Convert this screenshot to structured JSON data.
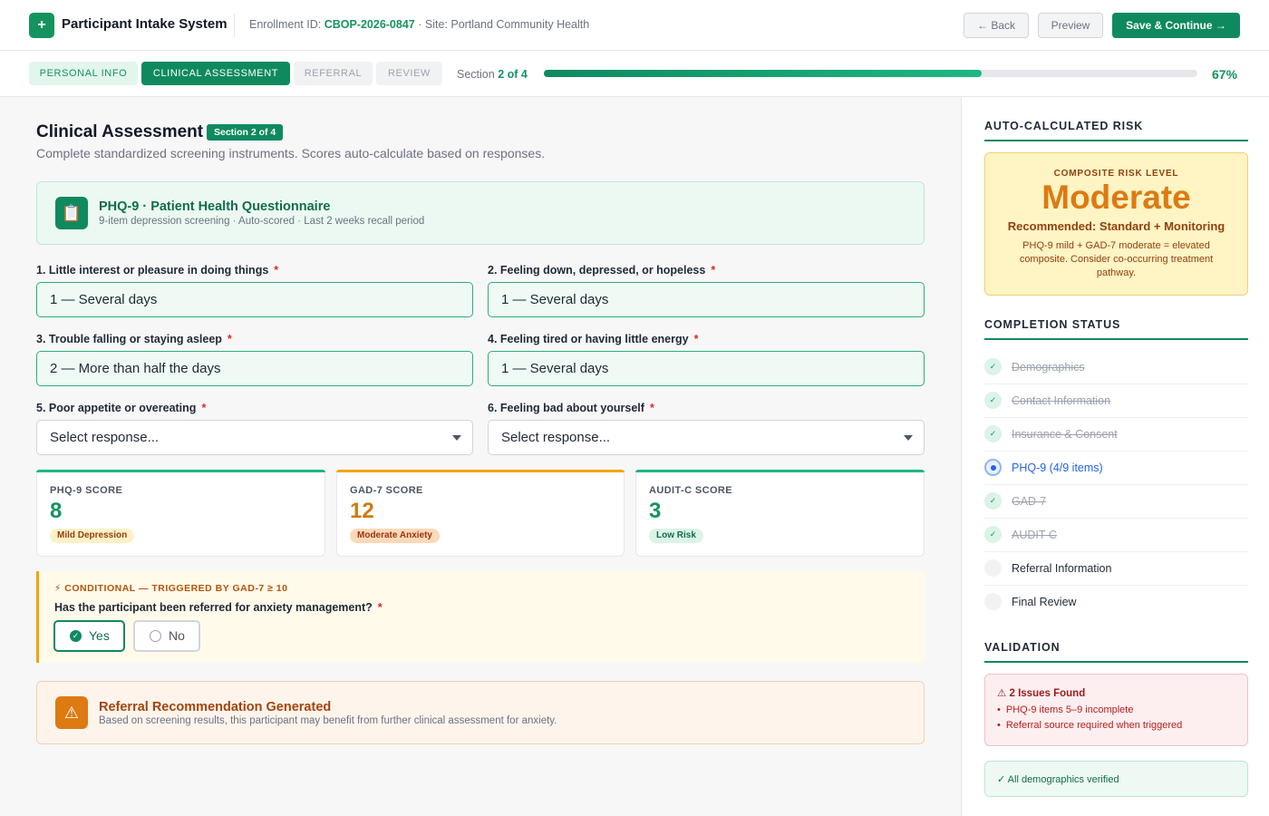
{
  "header": {
    "logo_glyph": "+",
    "app_title": "Participant Intake System",
    "enrollment_label": "Enrollment ID:",
    "enrollment_id": "CBOP-2026-0847",
    "site_text": "· Site: Portland Community Health",
    "back_label": "← Back",
    "preview_label": "Preview",
    "save_label": "Save & Continue →"
  },
  "tabs": [
    {
      "label": "PERSONAL INFO",
      "state": "done"
    },
    {
      "label": "CLINICAL ASSESSMENT",
      "state": "active"
    },
    {
      "label": "REFERRAL",
      "state": "future"
    },
    {
      "label": "REVIEW",
      "state": "future"
    }
  ],
  "progress": {
    "section_prefix": "Section",
    "section_value": "2 of 4",
    "percent": 67,
    "percent_label": "67%"
  },
  "page": {
    "title": "Clinical Assessment",
    "badge": "Section 2 of 4",
    "subtitle": "Complete standardized screening instruments. Scores auto-calculate based on responses."
  },
  "instrument": {
    "icon": "📋",
    "title": "PHQ-9 · Patient Health Questionnaire",
    "subtitle": "9-item depression screening · Auto-scored · Last 2 weeks recall period"
  },
  "questions": [
    {
      "label": "1. Little interest or pleasure in doing things",
      "required": "*",
      "value": "1 — Several days"
    },
    {
      "label": "2. Feeling down, depressed, or hopeless",
      "required": "*",
      "value": "1 — Several days"
    },
    {
      "label": "3. Trouble falling or staying asleep",
      "required": "*",
      "value": "2 — More than half the days"
    },
    {
      "label": "4. Feeling tired or having little energy",
      "required": "*",
      "value": "1 — Several days"
    },
    {
      "label": "5. Poor appetite or overeating",
      "required": "*",
      "placeholder": "Select response..."
    },
    {
      "label": "6. Feeling bad about yourself",
      "required": "*",
      "placeholder": "Select response..."
    }
  ],
  "scores": [
    {
      "label": "PHQ-9 SCORE",
      "value": "8",
      "pill": "Mild Depression",
      "color": "#15935f",
      "bar": "#1fb781",
      "pill_bg": "#fdf1c7",
      "pill_fg": "#92400e"
    },
    {
      "label": "GAD-7 SCORE",
      "value": "12",
      "pill": "Moderate Anxiety",
      "color": "#d07a10",
      "bar": "#f2a50c",
      "pill_bg": "#fcd9b8",
      "pill_fg": "#9a3412"
    },
    {
      "label": "AUDIT-C SCORE",
      "value": "3",
      "pill": "Low Risk",
      "color": "#15935f",
      "bar": "#1fb781",
      "pill_bg": "#dcf3e7",
      "pill_fg": "#0f6e4c"
    }
  ],
  "conditional": {
    "heading": "⚡ CONDITIONAL — TRIGGERED BY GAD-7 ≥ 10",
    "question": "Has the participant been referred for anxiety management?",
    "required": "*",
    "yes_label": "Yes",
    "no_label": "No",
    "selected": "Yes"
  },
  "referral": {
    "icon": "⚠",
    "title": "Referral Recommendation Generated",
    "subtitle": "Based on screening results, this participant may benefit from further clinical assessment for anxiety."
  },
  "sidebar": {
    "risk_heading": "AUTO-CALCULATED RISK",
    "risk_kicker": "COMPOSITE RISK LEVEL",
    "risk_level": "Moderate",
    "risk_recommendation": "Recommended: Standard + Monitoring",
    "risk_note": "PHQ-9 mild + GAD-7 moderate = elevated composite. Consider co-occurring treatment pathway.",
    "completion_heading": "COMPLETION STATUS",
    "completion": [
      {
        "label": "Demographics",
        "state": "done"
      },
      {
        "label": "Contact Information",
        "state": "done"
      },
      {
        "label": "Insurance & Consent",
        "state": "done"
      },
      {
        "label": "PHQ-9 (4/9 items)",
        "state": "active"
      },
      {
        "label": "GAD-7",
        "state": "done"
      },
      {
        "label": "AUDIT-C",
        "state": "done"
      },
      {
        "label": "Referral Information",
        "state": "pending"
      },
      {
        "label": "Final Review",
        "state": "pending"
      }
    ],
    "check_glyph": "✓",
    "validation_heading": "VALIDATION",
    "validation_title": "⚠ 2 Issues Found",
    "validation_items": [
      "PHQ-9 items 5–9 incomplete",
      "Referral source required when triggered"
    ],
    "validation_bullet": "•",
    "ok_text": "✓ All demographics verified"
  },
  "colors": {
    "primary": "#0f8a5f",
    "accent_orange": "#dd7a12",
    "active_blue": "#2563eb",
    "error_red": "#b91c1c"
  }
}
